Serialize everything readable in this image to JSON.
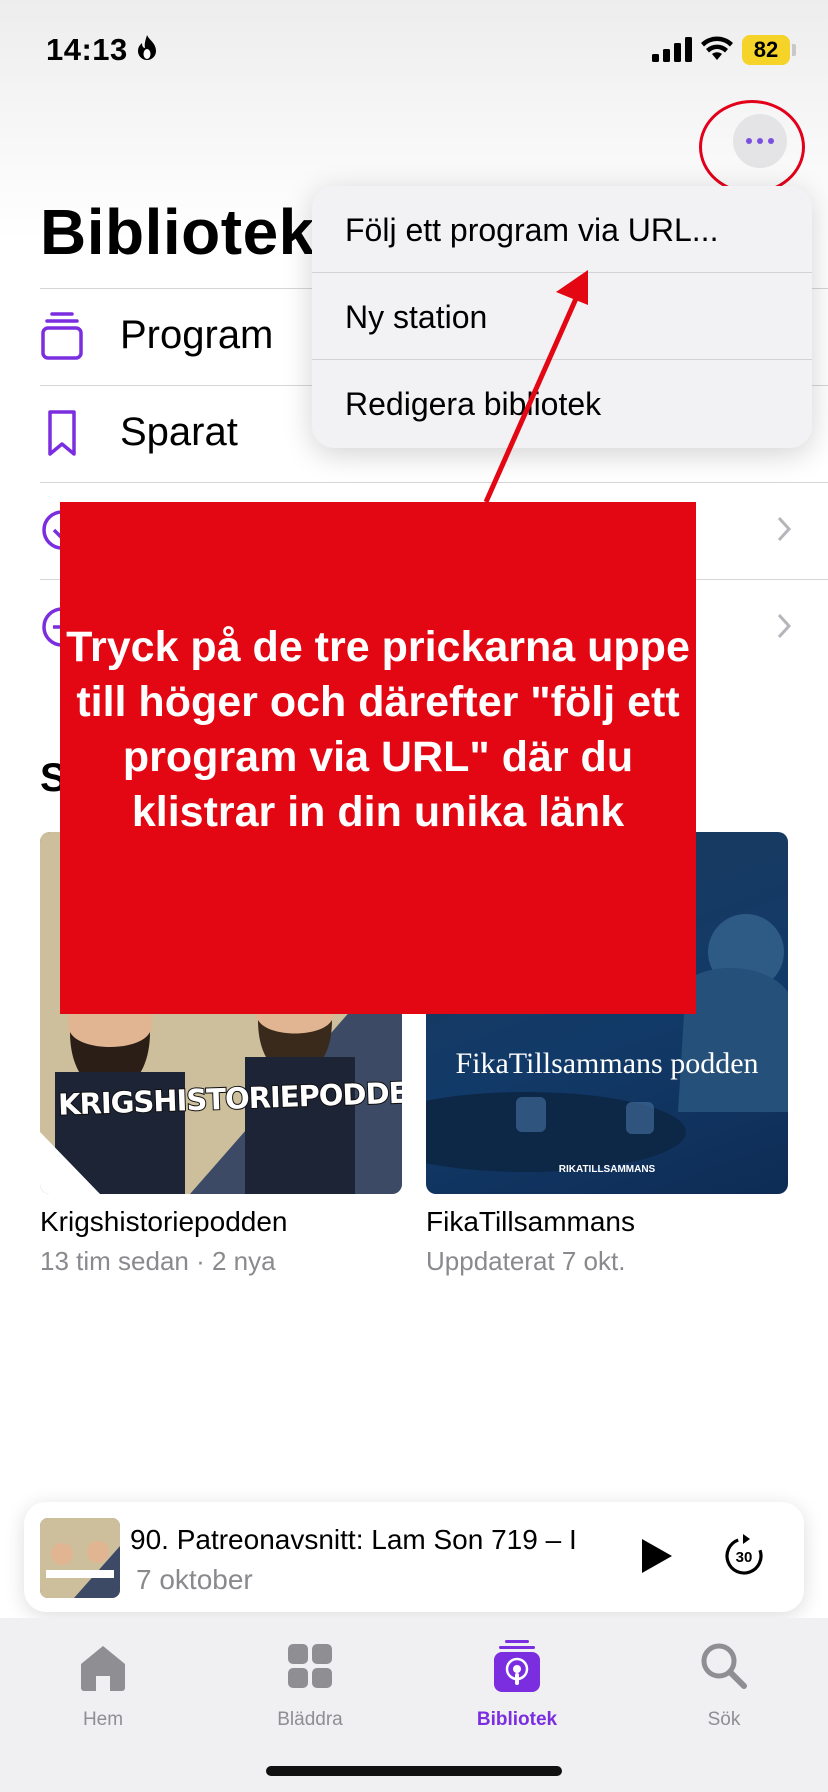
{
  "status_bar": {
    "time": "14:13",
    "battery": "82"
  },
  "page": {
    "title": "Bibliotek"
  },
  "library_items": [
    {
      "label": "Program",
      "icon": "stack-icon"
    },
    {
      "label": "Sparat",
      "icon": "bookmark-icon"
    },
    {
      "label": "",
      "icon": "checkmark-circle-icon"
    },
    {
      "label": "",
      "icon": "minus-circle-icon"
    }
  ],
  "section": {
    "title": "S"
  },
  "shows": [
    {
      "title": "Krigshistoriepodden",
      "subtitle": "13 tim sedan · 2 nya",
      "art_text": "KRIGSHISTORIEPODDEN"
    },
    {
      "title": "FikaTillsammans",
      "subtitle": "Uppdaterat 7 okt.",
      "art_text": "FikaTillsammans podden",
      "art_brand": "RIKATILLSAMMANS"
    }
  ],
  "menu": {
    "items": [
      "Följ ett program via URL...",
      "Ny station",
      "Redigera bibliotek"
    ]
  },
  "annotation": {
    "text": "Tryck på de tre prickarna uppe till höger och därefter \"följ ett program via URL\" där du klistrar in din unika länk",
    "color": "#e30613"
  },
  "player": {
    "episode_title": "90. Patreonavsnitt: Lam Son 719 – I",
    "date": "7 oktober"
  },
  "tabs": [
    {
      "label": "Hem",
      "icon": "house-icon"
    },
    {
      "label": "Bläddra",
      "icon": "grid-icon"
    },
    {
      "label": "Bibliotek",
      "icon": "podcast-library-icon",
      "active": true
    },
    {
      "label": "Sök",
      "icon": "magnifier-icon"
    }
  ],
  "colors": {
    "accent": "#7a2ee0",
    "annotation_red": "#e30613",
    "battery": "#f5d328"
  }
}
